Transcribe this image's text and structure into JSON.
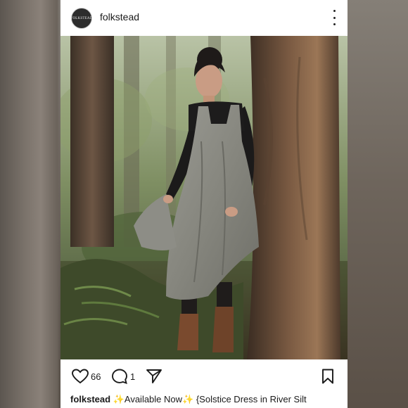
{
  "post": {
    "username": "folkstead",
    "avatar_text": "FOLKSTEAD",
    "likes": "66",
    "comments": "1",
    "caption_user": "folkstead",
    "caption_text": "✨Available Now✨ {Solstice Dress in River Silt"
  },
  "icons": {
    "more": "more-vertical-icon",
    "like": "heart-icon",
    "comment": "comment-icon",
    "share": "send-icon",
    "save": "bookmark-icon"
  },
  "colors": {
    "text": "#1a1a1a",
    "card": "#ffffff"
  }
}
